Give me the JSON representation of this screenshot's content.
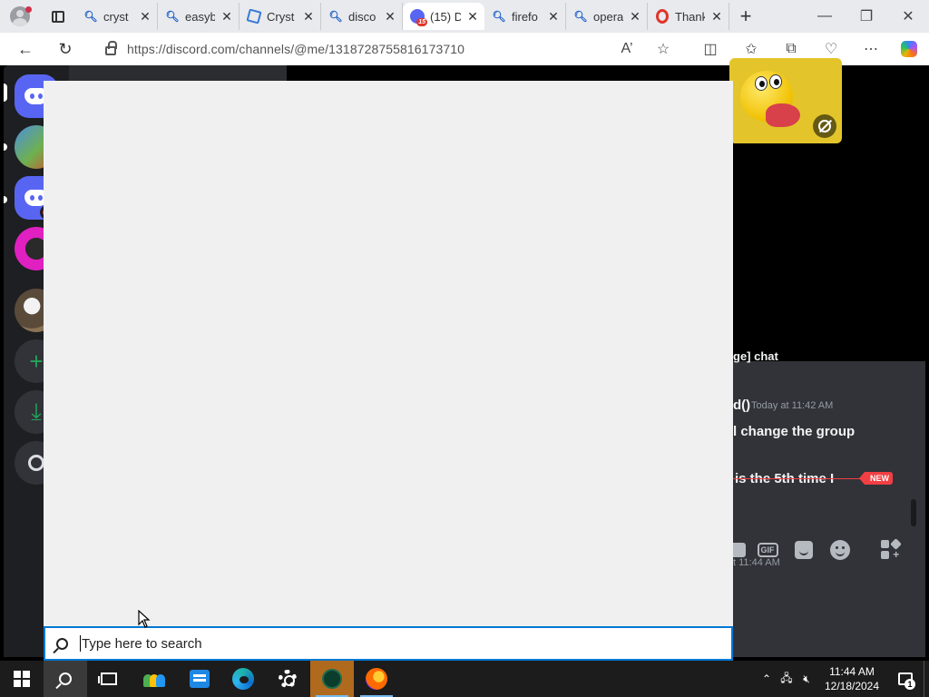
{
  "browser": {
    "tabs": [
      {
        "label": "cryst",
        "icon": "search-icon"
      },
      {
        "label": "easyb",
        "icon": "search-icon"
      },
      {
        "label": "Cryst",
        "icon": "crystal-icon"
      },
      {
        "label": "disco",
        "icon": "search-icon"
      },
      {
        "label": "(15) D",
        "icon": "discord-icon",
        "badge": "15",
        "active": true
      },
      {
        "label": "firefo",
        "icon": "search-icon"
      },
      {
        "label": "opera",
        "icon": "search-icon"
      },
      {
        "label": "Thank",
        "icon": "opera-icon"
      }
    ],
    "close_glyph": "✕",
    "new_tab_glyph": "+",
    "window_controls": {
      "minimize": "—",
      "restore": "❐",
      "close": "✕"
    },
    "url": "https://discord.com/channels/@me/1318728755816173710",
    "accent": "#0078d4"
  },
  "discord": {
    "messages": {
      "line1": "ge] chat",
      "author": "d()",
      "timestamp": "Today at 11:42 AM",
      "text1": "l change the group",
      "text2": "is the 5th time I",
      "new_label": "NEW",
      "timestamp2": "t 11:44 AM"
    },
    "composer": {
      "gif_label": "GIF"
    },
    "colors": {
      "blurple": "#5865f2",
      "mention_red": "#f23f43",
      "sticker_bg": "#e3c52b"
    }
  },
  "search": {
    "placeholder": "Type here to search"
  },
  "taskbar": {
    "apps": [
      "start-icon",
      "search-icon",
      "task-view-icon",
      "people-app-icon",
      "whiteboard-app-icon",
      "edge-icon",
      "settings-icon",
      "crystal-app-icon",
      "firefox-icon"
    ],
    "clock": {
      "time": "11:44 AM",
      "date": "12/18/2024"
    },
    "notifications_count": "1"
  }
}
